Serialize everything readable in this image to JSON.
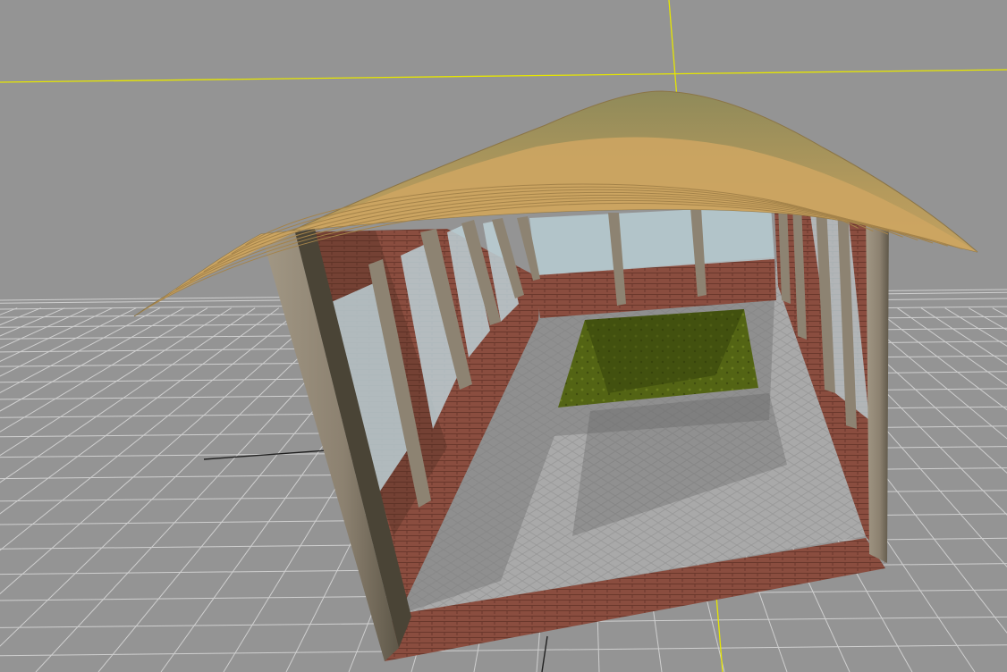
{
  "viewport": {
    "background_color": "#949494",
    "grid_color": "#cfcfcf",
    "axis_x_color": "#e8e800",
    "axis_y_color": "#e8e800",
    "axis_dark_color": "#222222"
  },
  "model": {
    "roof_color": "#c7a062",
    "roof_shade_color": "#8d7d48",
    "pillar_color": "#8f8470",
    "brick_color": "#8a4b3c",
    "glass_color": "#b6ccd2",
    "paving_color": "#aaaaaa",
    "grass_color": "#4e5f14"
  }
}
